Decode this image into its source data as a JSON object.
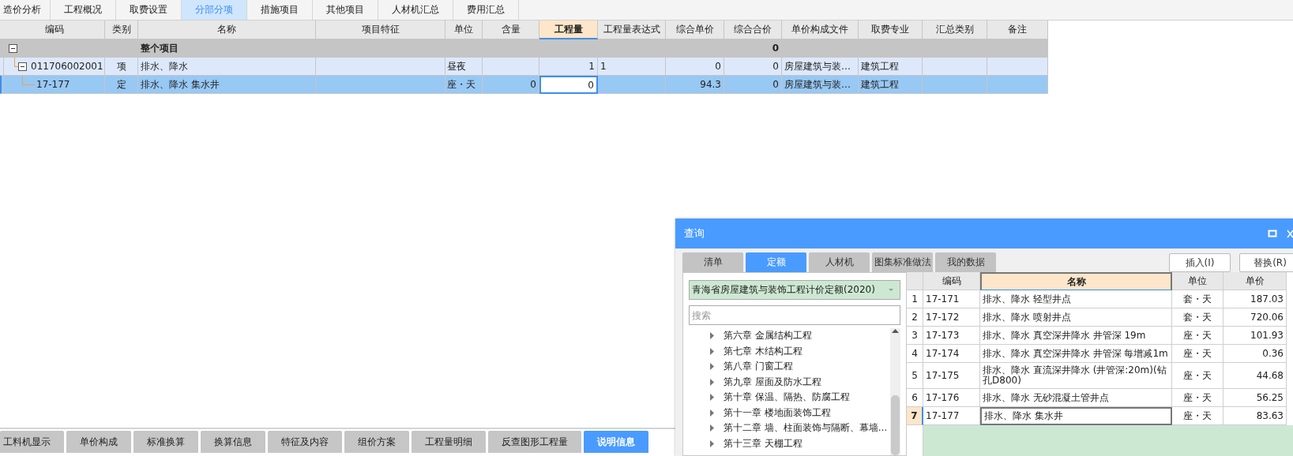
{
  "top_tabs": [
    {
      "label": "造价分析",
      "selected": false
    },
    {
      "label": "工程概况",
      "selected": false
    },
    {
      "label": "取费设置",
      "selected": false
    },
    {
      "label": "分部分项",
      "selected": true
    },
    {
      "label": "措施项目",
      "selected": false
    },
    {
      "label": "其他项目",
      "selected": false
    },
    {
      "label": "人材机汇总",
      "selected": false
    },
    {
      "label": "费用汇总",
      "selected": false
    }
  ],
  "table": {
    "columns": [
      {
        "label": "编码",
        "selected": false
      },
      {
        "label": "类别",
        "selected": false
      },
      {
        "label": "名称",
        "selected": false
      },
      {
        "label": "项目特征",
        "selected": false
      },
      {
        "label": "单位",
        "selected": false
      },
      {
        "label": "含量",
        "selected": false
      },
      {
        "label": "工程量",
        "selected": true
      },
      {
        "label": "工程量表达式",
        "selected": false
      },
      {
        "label": "综合单价",
        "selected": false
      },
      {
        "label": "综合合价",
        "selected": false
      },
      {
        "label": "单价构成文件",
        "selected": false
      },
      {
        "label": "取费专业",
        "selected": false
      },
      {
        "label": "汇总类别",
        "selected": false
      },
      {
        "label": "备注",
        "selected": false
      }
    ],
    "rows": [
      {
        "kind": "root",
        "name": "整个项目",
        "total": "0",
        "expanded": true,
        "selected": false,
        "children": [
          {
            "kind": "item",
            "code": "011706002001",
            "type": "项",
            "name": "排水、降水",
            "unit": "昼夜",
            "quantity": "1",
            "expression": "1",
            "unit_price": "0",
            "total": "0",
            "price_file": "房屋建筑与装…",
            "fee_type": "建筑工程",
            "expanded": true,
            "selected": false,
            "children": [
              {
                "kind": "sub",
                "code": "17-177",
                "type": "定",
                "name": "排水、降水 集水井",
                "unit": "座・天",
                "content": "0",
                "quantity": "0",
                "unit_price": "94.3",
                "total": "0",
                "price_file": "房屋建筑与装…",
                "fee_type": "建筑工程",
                "selected": true
              }
            ]
          }
        ]
      }
    ]
  },
  "dialog": {
    "title": "查询",
    "tabs": [
      {
        "label": "清单",
        "selected": false
      },
      {
        "label": "定额",
        "selected": true
      },
      {
        "label": "人材机",
        "selected": false
      },
      {
        "label": "图集标准做法",
        "selected": false
      },
      {
        "label": "我的数据",
        "selected": false
      }
    ],
    "buttons": [
      "插入(I)",
      "替换(R)"
    ],
    "library": "青海省房屋建筑与装饰工程计价定额(2020)",
    "search": {
      "placeholder": "搜索"
    },
    "chapters": [
      {
        "label": "第六章 金属结构工程",
        "expanded": false
      },
      {
        "label": "第七章 木结构工程",
        "expanded": false
      },
      {
        "label": "第八章 门窗工程",
        "expanded": false
      },
      {
        "label": "第九章 屋面及防水工程",
        "expanded": false
      },
      {
        "label": "第十章 保温、隔热、防腐工程",
        "expanded": false
      },
      {
        "label": "第十一章 楼地面装饰工程",
        "expanded": false
      },
      {
        "label": "第十二章 墙、柱面装饰与隔断、幕墙…",
        "expanded": false
      },
      {
        "label": "第十三章 天棚工程",
        "expanded": false
      }
    ],
    "columns": [
      {
        "label": "编码",
        "selected": false
      },
      {
        "label": "名称",
        "selected": true
      },
      {
        "label": "单位",
        "selected": false
      },
      {
        "label": "单价",
        "selected": false
      }
    ],
    "rows": [
      {
        "number": "1",
        "code": "17-171",
        "name": "排水、降水 轻型井点",
        "unit": "套・天",
        "price": "187.03",
        "selected": false
      },
      {
        "number": "2",
        "code": "17-172",
        "name": "排水、降水 喷射井点",
        "unit": "套・天",
        "price": "720.06",
        "selected": false
      },
      {
        "number": "3",
        "code": "17-173",
        "name": "排水、降水 真空深井降水 井管深 19m",
        "unit": "座・天",
        "price": "101.93",
        "selected": false
      },
      {
        "number": "4",
        "code": "17-174",
        "name": "排水、降水 真空深井降水 井管深 每增减1m",
        "unit": "座・天",
        "price": "0.36",
        "selected": false
      },
      {
        "number": "5",
        "code": "17-175",
        "name": "排水、降水 直流深井降水 (井管深:20m)(钻孔D800)",
        "unit": "座・天",
        "price": "44.68",
        "selected": false
      },
      {
        "number": "6",
        "code": "17-176",
        "name": "排水、降水 无砂混凝土管井点",
        "unit": "座・天",
        "price": "56.25",
        "selected": false
      },
      {
        "number": "7",
        "code": "17-177",
        "name": "排水、降水 集水井",
        "unit": "座・天",
        "price": "83.63",
        "selected": true
      }
    ]
  },
  "bottom_tabs": [
    {
      "label": "工料机显示",
      "selected": false
    },
    {
      "label": "单价构成",
      "selected": false
    },
    {
      "label": "标准换算",
      "selected": false
    },
    {
      "label": "换算信息",
      "selected": false
    },
    {
      "label": "特征及内容",
      "selected": false
    },
    {
      "label": "组价方案",
      "selected": false
    },
    {
      "label": "工程量明细",
      "selected": false
    },
    {
      "label": "反查图形工程量",
      "selected": false
    },
    {
      "label": "说明信息",
      "selected": true
    }
  ]
}
